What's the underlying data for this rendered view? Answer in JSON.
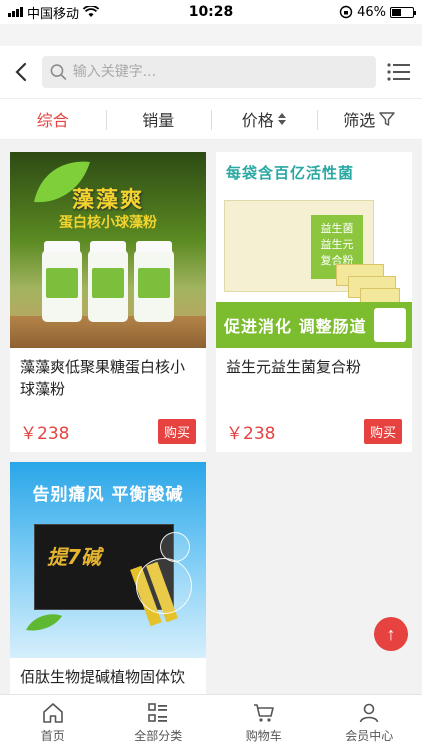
{
  "status": {
    "carrier": "中国移动",
    "time": "10:28",
    "battery": "46%",
    "battery_level": 0.46
  },
  "search": {
    "placeholder": "输入关键字..."
  },
  "filters": [
    {
      "label": "综合",
      "active": true
    },
    {
      "label": "销量",
      "active": false
    },
    {
      "label": "价格",
      "active": false
    },
    {
      "label": "筛选",
      "active": false
    }
  ],
  "products": [
    {
      "title": "藻藻爽低聚果糖蛋白核小球藻粉",
      "price": "￥238",
      "buy_label": "购买",
      "image_text": {
        "headline": "藻藻爽",
        "sub": "蛋白核小球藻粉"
      }
    },
    {
      "title": "益生元益生菌复合粉",
      "price": "￥238",
      "buy_label": "购买",
      "image_text": {
        "headline": "每袋含百亿活性菌",
        "box_line1": "益生菌",
        "box_line2": "益生元",
        "box_line3": "复合粉",
        "band": "促进消化 调整肠道"
      }
    },
    {
      "title": "佰肽生物提碱植物固体饮",
      "image_text": {
        "headline": "告别痛风 平衡酸碱",
        "box_brand": "提7碱"
      }
    }
  ],
  "back_to_top": "↑",
  "tabs": [
    {
      "label": "首页",
      "icon": "home-icon"
    },
    {
      "label": "全部分类",
      "icon": "category-icon"
    },
    {
      "label": "购物车",
      "icon": "cart-icon"
    },
    {
      "label": "会员中心",
      "icon": "user-icon"
    }
  ],
  "colors": {
    "accent": "#e64340"
  }
}
